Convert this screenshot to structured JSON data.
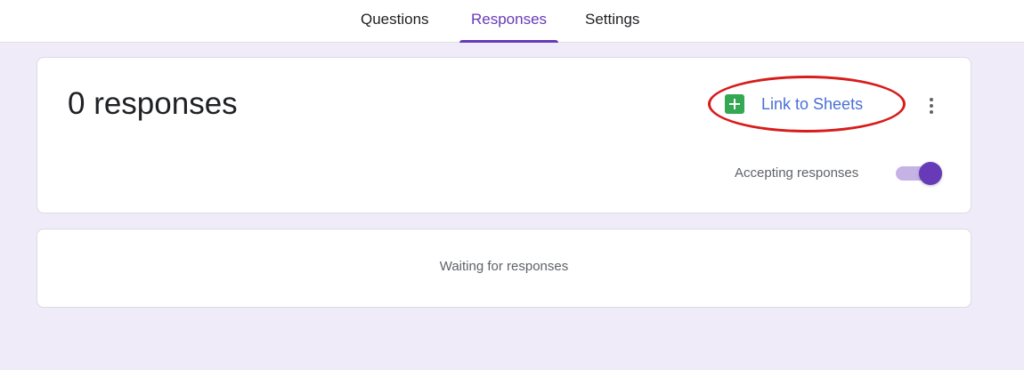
{
  "tabs": [
    {
      "label": "Questions",
      "active": false
    },
    {
      "label": "Responses",
      "active": true
    },
    {
      "label": "Settings",
      "active": false
    }
  ],
  "summary": {
    "title": "0 responses",
    "link_label": "Link to Sheets",
    "link_icon": "google-sheets-icon",
    "more_icon": "more-vert-icon",
    "accepting_label": "Accepting responses",
    "accepting_on": true
  },
  "empty_state": {
    "message": "Waiting for responses"
  },
  "colors": {
    "accent": "#673ab7",
    "background": "#f0ebf8",
    "link": "#4a6fd8",
    "sheets_green": "#34a853",
    "highlight_circle": "#d81c1c"
  }
}
